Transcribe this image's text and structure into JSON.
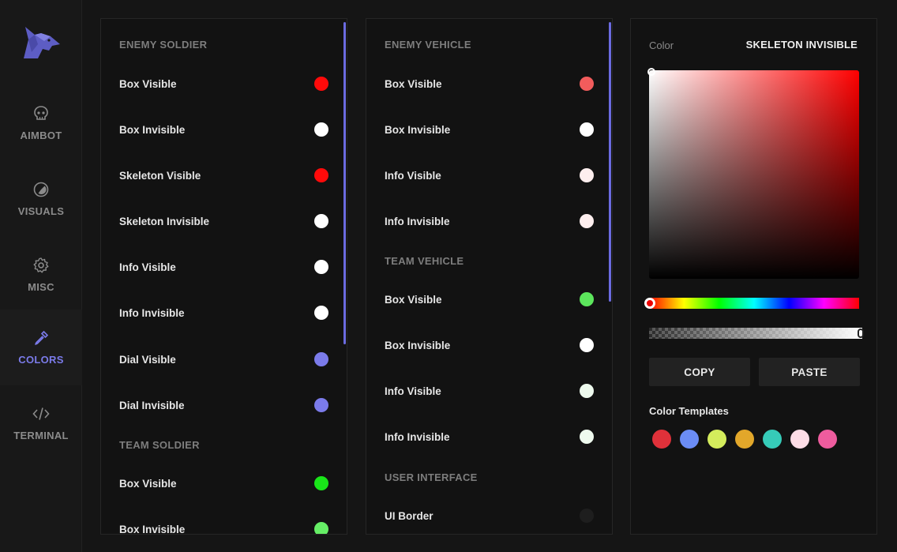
{
  "sidebar": {
    "items": [
      {
        "label": "AIMBOT",
        "icon": "skull-icon",
        "active": false
      },
      {
        "label": "VISUALS",
        "icon": "eye-icon",
        "active": false
      },
      {
        "label": "MISC",
        "icon": "gear-icon",
        "active": false
      },
      {
        "label": "COLORS",
        "icon": "eyedropper-icon",
        "active": true
      },
      {
        "label": "TERMINAL",
        "icon": "code-icon",
        "active": false
      }
    ]
  },
  "colors": {
    "accent": "#7b7bea",
    "background": "#151515",
    "panel": "#121212"
  },
  "left_panel": {
    "sections": [
      {
        "title": "ENEMY SOLDIER",
        "items": [
          {
            "label": "Box Visible",
            "color": "#ff0a0a"
          },
          {
            "label": "Box Invisible",
            "color": "#ffffff"
          },
          {
            "label": "Skeleton Visible",
            "color": "#ff0a0a"
          },
          {
            "label": "Skeleton Invisible",
            "color": "#ffffff"
          },
          {
            "label": "Info Visible",
            "color": "#ffffff"
          },
          {
            "label": "Info Invisible",
            "color": "#ffffff"
          },
          {
            "label": "Dial Visible",
            "color": "#7b7bea"
          },
          {
            "label": "Dial Invisible",
            "color": "#7b7bea"
          }
        ]
      },
      {
        "title": "TEAM SOLDIER",
        "items": [
          {
            "label": "Box Visible",
            "color": "#19e619"
          },
          {
            "label": "Box Invisible",
            "color": "#66ee66"
          }
        ]
      }
    ]
  },
  "mid_panel": {
    "sections": [
      {
        "title": "ENEMY VEHICLE",
        "items": [
          {
            "label": "Box Visible",
            "color": "#f25c5c"
          },
          {
            "label": "Box Invisible",
            "color": "#ffffff"
          },
          {
            "label": "Info Visible",
            "color": "#fdeeee"
          },
          {
            "label": "Info Invisible",
            "color": "#fdeeee"
          }
        ]
      },
      {
        "title": "TEAM VEHICLE",
        "items": [
          {
            "label": "Box Visible",
            "color": "#5ce65c"
          },
          {
            "label": "Box Invisible",
            "color": "#ffffff"
          },
          {
            "label": "Info Visible",
            "color": "#eefaee"
          },
          {
            "label": "Info Invisible",
            "color": "#eefaee"
          }
        ]
      },
      {
        "title": "USER INTERFACE",
        "items": [
          {
            "label": "UI Border",
            "color": "#1e1e1e"
          }
        ]
      }
    ]
  },
  "picker": {
    "title": "Color",
    "target": "SKELETON INVISIBLE",
    "copy_label": "COPY",
    "paste_label": "PASTE",
    "templates_title": "Color Templates",
    "templates": [
      "#e0313a",
      "#6b8cf5",
      "#d4ec5c",
      "#e2a72a",
      "#36cbb8",
      "#fddde6",
      "#ee5c9e"
    ]
  }
}
